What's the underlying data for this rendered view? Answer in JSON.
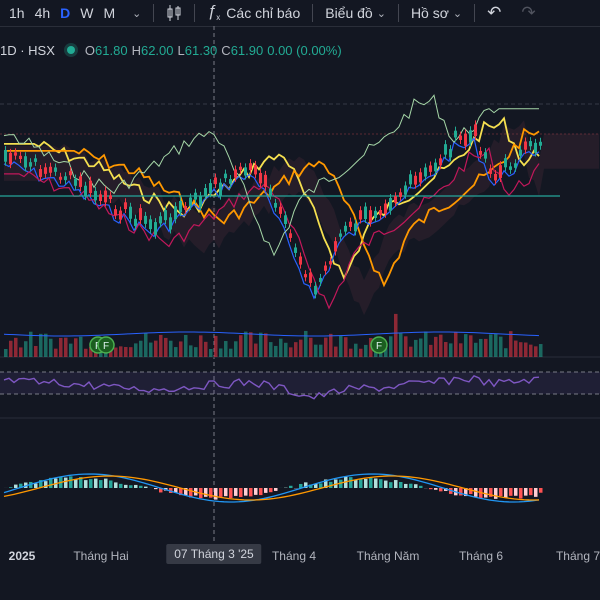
{
  "toolbar": {
    "intervals": [
      "1h",
      "4h",
      "D",
      "W",
      "M"
    ],
    "active_interval": "D",
    "indicators_label": "Các chỉ báo",
    "chart_type_label": "Biểu đồ",
    "profile_label": "Hồ sơ"
  },
  "legend": {
    "symbol": "1D · HSX",
    "open_key": "O",
    "open": "61.80",
    "high_key": "H",
    "high": "62.00",
    "low_key": "L",
    "low": "61.30",
    "close_key": "C",
    "close": "61.90",
    "change": "0.00 (0.00%)"
  },
  "xaxis": {
    "labels": [
      "2025",
      "Tháng Hai",
      "Tháng 4",
      "Tháng Năm",
      "Tháng 6",
      "Tháng 7"
    ],
    "crosshair_label": "07 Tháng 3 '25"
  },
  "colors": {
    "up": "#22ab94",
    "down": "#f23645",
    "background": "#131722",
    "accent": "#2962ff",
    "ma_yellow": "#f5e050",
    "ma_orange": "#ff9800",
    "rsi": "#7e57c2"
  },
  "icons": {
    "interval_menu": "chevron-down-icon",
    "candle_type": "candles-icon",
    "indicators": "fx-icon",
    "undo": "undo-icon",
    "redo": "redo-icon"
  }
}
